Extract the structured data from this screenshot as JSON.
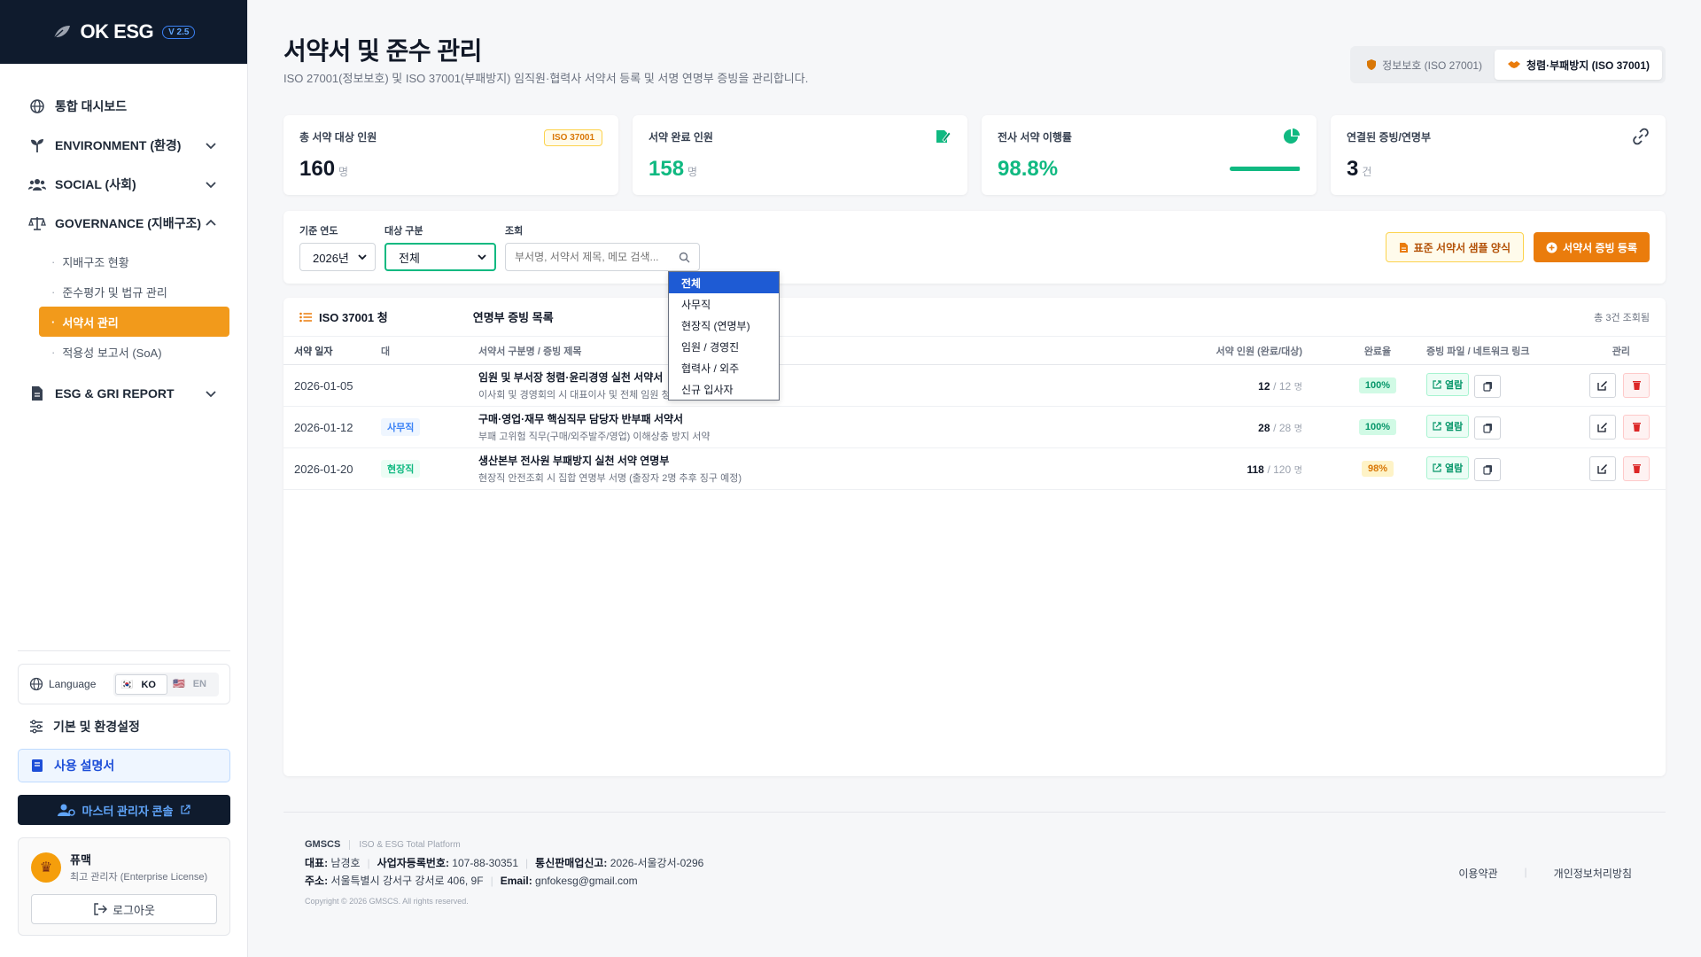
{
  "brand": {
    "name": "OK ESG",
    "version": "V 2.5"
  },
  "sidebar": {
    "items": [
      {
        "label": "통합 대시보드"
      },
      {
        "label": "ENVIRONMENT (환경)"
      },
      {
        "label": "SOCIAL (사회)"
      },
      {
        "label": "GOVERNANCE (지배구조)"
      },
      {
        "label": "ESG & GRI REPORT"
      }
    ],
    "governance_sub": [
      {
        "label": "지배구조 현황"
      },
      {
        "label": "준수평가 및 법규 관리"
      },
      {
        "label": "서약서 관리"
      },
      {
        "label": "적용성 보고서 (SoA)"
      }
    ],
    "language_label": "Language",
    "lang_ko": "KO",
    "lang_en": "EN",
    "settings_label": "기본 및 환경설정",
    "manual_label": "사용 설명서",
    "master_console_label": "마스터 관리자 콘솔",
    "user": {
      "name": "퓨맥",
      "role": "최고 관리자 (Enterprise License)"
    },
    "logout_label": "로그아웃"
  },
  "header": {
    "title": "서약서 및 준수 관리",
    "subtitle": "ISO 27001(정보보호) 및 ISO 37001(부패방지) 임직원·협력사 서약서 등록 및 서명 연명부 증빙을 관리합니다.",
    "tabs": [
      {
        "label": "정보보호 (ISO 27001)"
      },
      {
        "label": "청렴·부패방지 (ISO 37001)"
      }
    ]
  },
  "stats": [
    {
      "label": "총 서약 대상 인원",
      "value": "160",
      "unit": "명",
      "badge": "ISO 37001"
    },
    {
      "label": "서약 완료 인원",
      "value": "158",
      "unit": "명"
    },
    {
      "label": "전사 서약 이행률",
      "value": "98.8%",
      "progress": 0.988
    },
    {
      "label": "연결된 증빙/연명부",
      "value": "3",
      "unit": "건"
    }
  ],
  "filters": {
    "year_label": "기준 연도",
    "year_value": "2026년",
    "target_label": "대상 구분",
    "target_value": "전체",
    "search_label": "조회",
    "search_placeholder": "부서명, 서약서 제목, 메모 검색...",
    "sample_button": "표준 서약서 샘플 양식",
    "register_button": "서약서 증빙 등록",
    "dropdown_options": [
      "전체",
      "사무직",
      "현장직 (연명부)",
      "임원 / 경영진",
      "협력사 / 외주",
      "신규 입사자"
    ]
  },
  "table": {
    "title_left": "ISO 37001 청",
    "title_right": "연명부 증빙 목록",
    "count": "총 3건 조회됨",
    "headers": {
      "date": "서약 일자",
      "type": "대",
      "title": "서약서 구분명 / 증빙 제목",
      "people": "서약 인원 (완료/대상)",
      "rate": "완료율",
      "file": "증빙 파일 / 네트워크 링크",
      "manage": "관리"
    },
    "rows": [
      {
        "date": "2026-01-05",
        "type": "",
        "title": "임원 및 부서장 청렴·윤리경영 실천 서약서",
        "desc": "이사회 및 경영회의 시 대표이사 및 전체 임원 청렴 서약 서명본",
        "done": "12",
        "total": "/ 12",
        "unit": "명",
        "rate": "100%",
        "view": "열람"
      },
      {
        "date": "2026-01-12",
        "type": "사무직",
        "title": "구매·영업·재무 핵심직무 담당자 반부패 서약서",
        "desc": "부패 고위험 직무(구매/외주발주/영업) 이해상충 방지 서약",
        "done": "28",
        "total": "/ 28",
        "unit": "명",
        "rate": "100%",
        "view": "열람"
      },
      {
        "date": "2026-01-20",
        "type": "현장직",
        "title": "생산본부 전사원 부패방지 실천 서약 연명부",
        "desc": "현장직 안전조회 시 집합 연명부 서명 (출장자 2명 추후 징구 예정)",
        "done": "118",
        "total": "/ 120",
        "unit": "명",
        "rate": "98%",
        "view": "열람"
      }
    ]
  },
  "footer": {
    "brand": "GMSCS",
    "slogan": "ISO & ESG Total Platform",
    "ceo_label": "대표:",
    "ceo": "남경호",
    "biz_label": "사업자등록번호:",
    "biz": "107-88-30351",
    "mail_order_label": "통신판매업신고:",
    "mail_order": "2026-서울강서-0296",
    "addr_label": "주소:",
    "addr": "서울특별시 강서구 강서로 406, 9F",
    "email_label": "Email:",
    "email": "gnfokesg@gmail.com",
    "copyright": "Copyright © 2026 GMSCS. All rights reserved.",
    "terms": "이용약관",
    "privacy": "개인정보처리방침"
  },
  "colors": {
    "accent": "#f29a1b",
    "primary_dark": "#0f1b2d",
    "success": "#10b981",
    "register": "#ea7c0c"
  }
}
